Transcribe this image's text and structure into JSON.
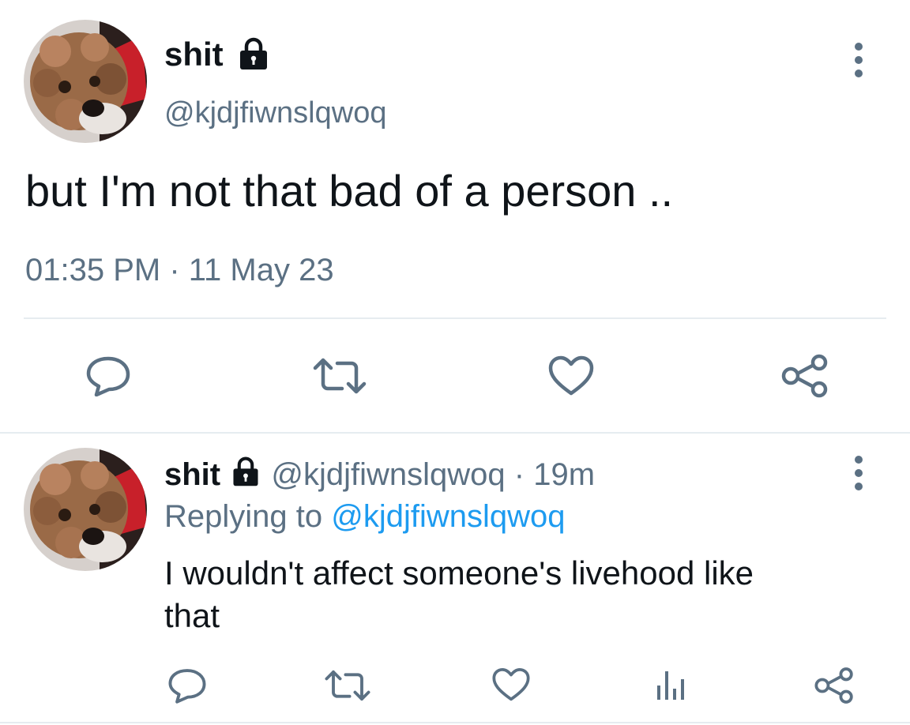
{
  "main_tweet": {
    "display_name": "shit",
    "handle": "@kjdjfiwnslqwoq",
    "text": "but I'm not that bad of a person ..",
    "timestamp": "01:35 PM · 11 May 23",
    "avatar_icon": "dog-photo",
    "lock_icon": "lock-icon",
    "actions": [
      "reply-icon",
      "retweet-icon",
      "like-icon",
      "share-icon"
    ]
  },
  "reply_tweet": {
    "display_name": "shit",
    "handle": "@kjdjfiwnslqwoq",
    "age": "· 19m",
    "replying_prefix": "Replying to",
    "replying_handle": "@kjdjfiwnslqwoq",
    "text_line1": "I wouldn't affect someone's livehood like",
    "text_line2": "that",
    "actions": [
      "reply-icon",
      "retweet-icon",
      "like-icon",
      "analytics-icon",
      "share-icon"
    ]
  },
  "colors": {
    "text": "#0f1419",
    "secondary": "#5b7083",
    "link": "#1d9bf0",
    "divider": "#e6ecf0"
  }
}
